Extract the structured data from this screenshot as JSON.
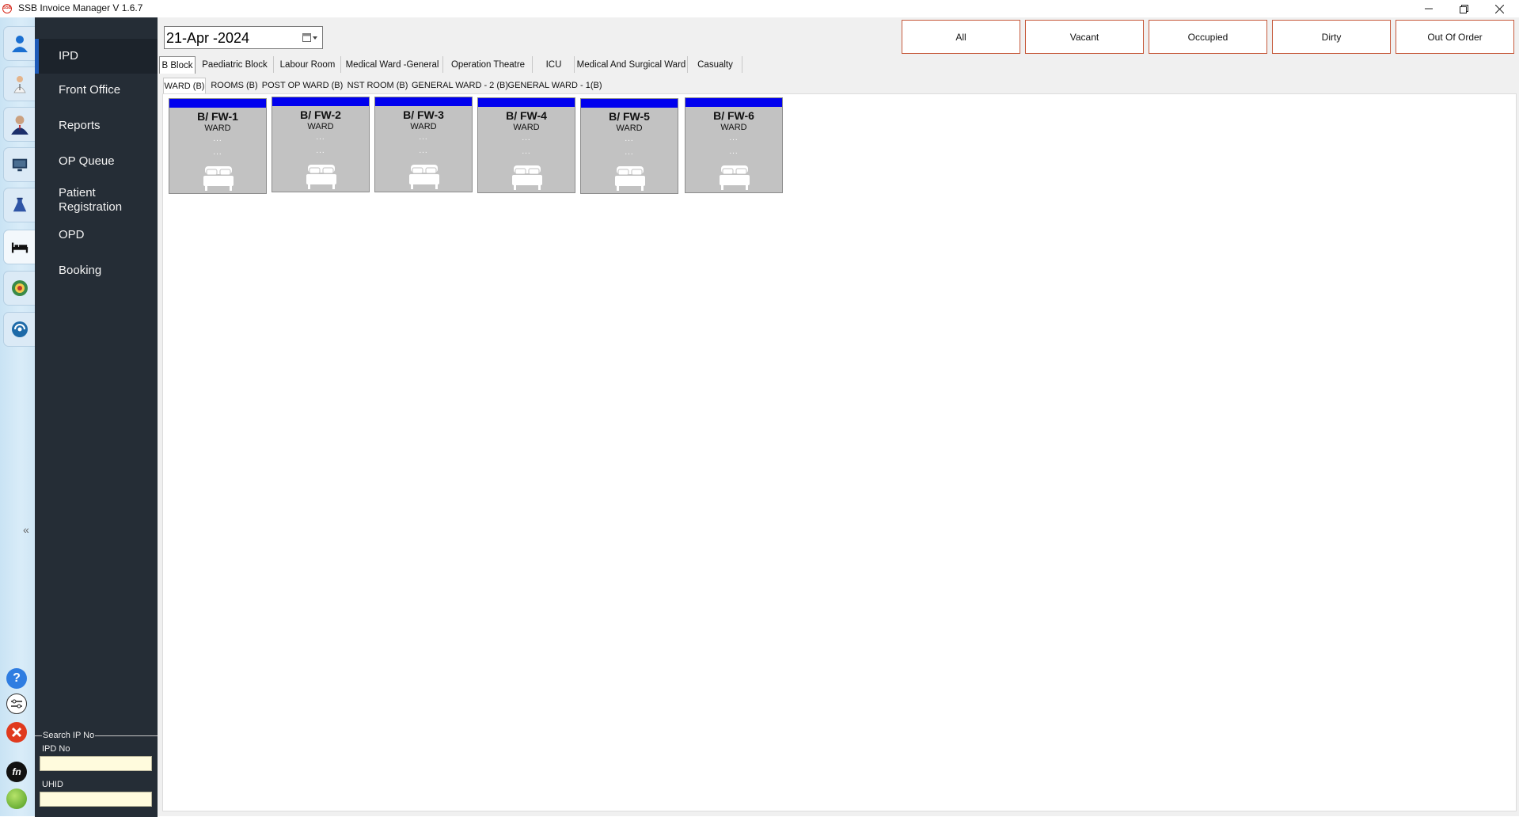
{
  "window": {
    "title": "SSB Invoice Manager V 1.6.7",
    "logo_text": "SSB"
  },
  "icon_strip": {
    "items": [
      {
        "name": "patient-icon"
      },
      {
        "name": "doctor-icon"
      },
      {
        "name": "staff-icon"
      },
      {
        "name": "monitor-icon"
      },
      {
        "name": "lab-flask-icon"
      },
      {
        "name": "bed-icon",
        "active": true
      },
      {
        "name": "pharmacy-icon"
      },
      {
        "name": "sync-icon"
      }
    ],
    "collapse_label": "«",
    "bottom": [
      {
        "name": "help-icon"
      },
      {
        "name": "settings-icon"
      },
      {
        "name": "exit-icon"
      },
      {
        "name": "fn-icon"
      },
      {
        "name": "status-icon"
      }
    ]
  },
  "nav": {
    "items": [
      {
        "label": "IPD",
        "active": true
      },
      {
        "label": "Front Office"
      },
      {
        "label": "Reports"
      },
      {
        "label": "OP Queue"
      },
      {
        "label": "Patient",
        "label2": "Registration"
      },
      {
        "label": "OPD"
      },
      {
        "label": "Booking"
      }
    ],
    "search": {
      "title": "Search IP No",
      "ipd_label": "IPD No",
      "ipd_value": "",
      "uhid_label": "UHID",
      "uhid_value": ""
    }
  },
  "header": {
    "date": "21-Apr -2024",
    "filters": [
      "All",
      "Vacant",
      "Occupied",
      "Dirty",
      "Out Of Order"
    ]
  },
  "block_tabs": [
    {
      "label": "B Block",
      "active": true
    },
    {
      "label": "Paediatric Block"
    },
    {
      "label": "Labour Room"
    },
    {
      "label": "Medical Ward -General"
    },
    {
      "label": "Operation Theatre"
    },
    {
      "label": "ICU"
    },
    {
      "label": "Medical And Surgical Ward"
    },
    {
      "label": "Casualty"
    }
  ],
  "ward_tabs": [
    {
      "label": "WARD (B)",
      "active": true
    },
    {
      "label": "ROOMS (B)"
    },
    {
      "label": "POST OP WARD (B)"
    },
    {
      "label": "NST ROOM (B)"
    },
    {
      "label": "GENERAL WARD - 2 (B)"
    },
    {
      "label": "GENERAL WARD - 1(B)"
    }
  ],
  "beds": [
    {
      "name": "B/ FW-1",
      "type": "WARD",
      "line1": "...",
      "line2": "...",
      "status_color": "#0000ee"
    },
    {
      "name": "B/ FW-2",
      "type": "WARD",
      "line1": "...",
      "line2": "...",
      "status_color": "#0000ee"
    },
    {
      "name": "B/ FW-3",
      "type": "WARD",
      "line1": "...",
      "line2": "...",
      "status_color": "#0000ee"
    },
    {
      "name": "B/ FW-4",
      "type": "WARD",
      "line1": "...",
      "line2": "...",
      "status_color": "#0000ee"
    },
    {
      "name": "B/ FW-5",
      "type": "WARD",
      "line1": "...",
      "line2": "...",
      "status_color": "#0000ee"
    },
    {
      "name": "B/ FW-6",
      "type": "WARD",
      "line1": "...",
      "line2": "...",
      "status_color": "#0000ee"
    }
  ]
}
